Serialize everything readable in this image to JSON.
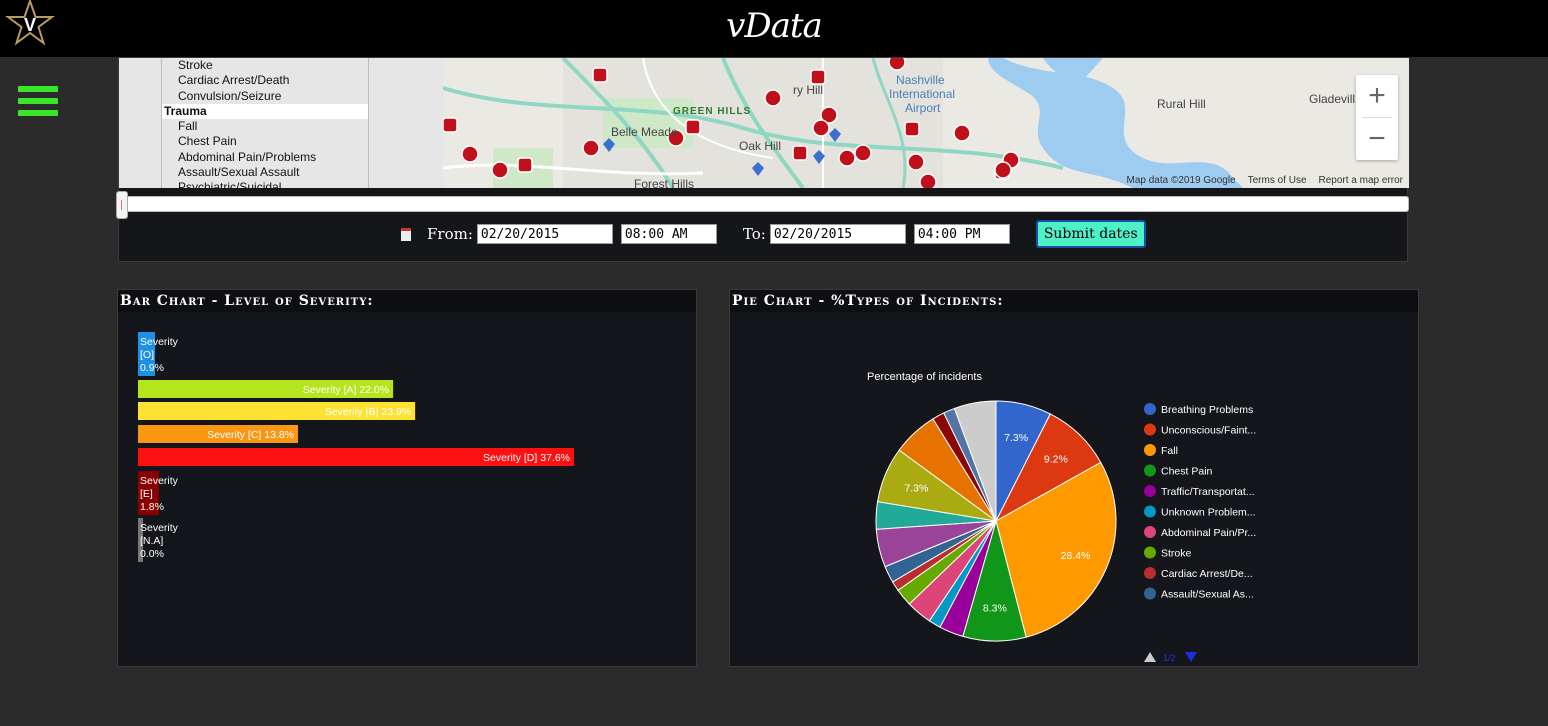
{
  "app": {
    "brand": "vData"
  },
  "listbox": {
    "items": [
      {
        "label": "Stroke",
        "group": false
      },
      {
        "label": "Cardiac Arrest/Death",
        "group": false
      },
      {
        "label": "Convulsion/Seizure",
        "group": false
      },
      {
        "label": "Trauma",
        "group": true
      },
      {
        "label": "Fall",
        "group": false
      },
      {
        "label": "Chest Pain",
        "group": false
      },
      {
        "label": "Abdominal Pain/Problems",
        "group": false
      },
      {
        "label": "Assault/Sexual Assault",
        "group": false
      },
      {
        "label": "Psychiatric/Suicidal",
        "group": false
      }
    ]
  },
  "map": {
    "labels": [
      "Nashville International Airport",
      "GREEN HILLS",
      "Belle Meade",
      "Oak Hill",
      "Forest Hills",
      "Rural Hill",
      "Gladevill",
      "ry Hill"
    ],
    "attribution": [
      "Map data ©2019 Google",
      "Terms of Use",
      "Report a map error"
    ],
    "zoom_in": "+",
    "zoom_out": "−"
  },
  "dates": {
    "from_label": "From:",
    "from_date": "02/20/2015",
    "from_time": "08:00 AM",
    "to_label": "To:",
    "to_date": "02/20/2015",
    "to_time": "04:00 PM",
    "submit": "Submit dates"
  },
  "bar_card": {
    "title": "Bar Chart - Level of Severity:"
  },
  "pie_card": {
    "title": "Pie Chart - %Types of Incidents:",
    "pager": "1/2"
  },
  "chart_data": [
    {
      "type": "bar",
      "orientation": "horizontal",
      "title": "",
      "categories": [
        "Severity [O]",
        "Severity [A]",
        "Severity [B]",
        "Severity [C]",
        "Severity [D]",
        "Severity [E]",
        "Severity [N.A]"
      ],
      "values": [
        0.9,
        22.0,
        23.9,
        13.8,
        37.6,
        1.8,
        0.0
      ],
      "labels": [
        "Severity [O] 0.9%",
        "Severity [A] 22.0%",
        "Severity [B] 23.9%",
        "Severity [C] 13.8%",
        "Severity [D] 37.6%",
        "Severity [E] 1.8%",
        "Severity [N.A] 0.0%"
      ],
      "colors": [
        "#1e90e6",
        "#b5e61d",
        "#fde231",
        "#f99612",
        "#ff1010",
        "#8a0000",
        "#777777"
      ]
    },
    {
      "type": "pie",
      "title": "Percentage of incidents",
      "legend": [
        "Breathing Problems",
        "Unconscious/Faint...",
        "Fall",
        "Chest Pain",
        "Traffic/Transportat...",
        "Unknown Problem...",
        "Abdominal Pain/Pr...",
        "Stroke",
        "Cardiac Arrest/De...",
        "Assault/Sexual As..."
      ],
      "slices": [
        {
          "value": 7.3,
          "color": "#3366cc",
          "label": "7.3%"
        },
        {
          "value": 9.2,
          "color": "#dc3912",
          "label": "9.2%"
        },
        {
          "value": 28.4,
          "color": "#ff9900",
          "label": "28.4%"
        },
        {
          "value": 8.3,
          "color": "#109618",
          "label": "8.3%"
        },
        {
          "value": 3.2,
          "color": "#990099",
          "label": ""
        },
        {
          "value": 1.6,
          "color": "#0099c6",
          "label": ""
        },
        {
          "value": 3.4,
          "color": "#dd4477",
          "label": ""
        },
        {
          "value": 2.3,
          "color": "#66aa00",
          "label": ""
        },
        {
          "value": 1.3,
          "color": "#b82e2e",
          "label": ""
        },
        {
          "value": 2.2,
          "color": "#316395",
          "label": ""
        },
        {
          "value": 5.0,
          "color": "#994499",
          "label": ""
        },
        {
          "value": 3.6,
          "color": "#22aa99",
          "label": ""
        },
        {
          "value": 7.3,
          "color": "#aaaa11",
          "label": "7.3%"
        },
        {
          "value": 6.0,
          "color": "#e67300",
          "label": ""
        },
        {
          "value": 1.6,
          "color": "#8b0707",
          "label": ""
        },
        {
          "value": 1.5,
          "color": "#5574a6",
          "label": ""
        },
        {
          "value": 5.5,
          "color": "#cccccc",
          "label": ""
        }
      ]
    }
  ]
}
